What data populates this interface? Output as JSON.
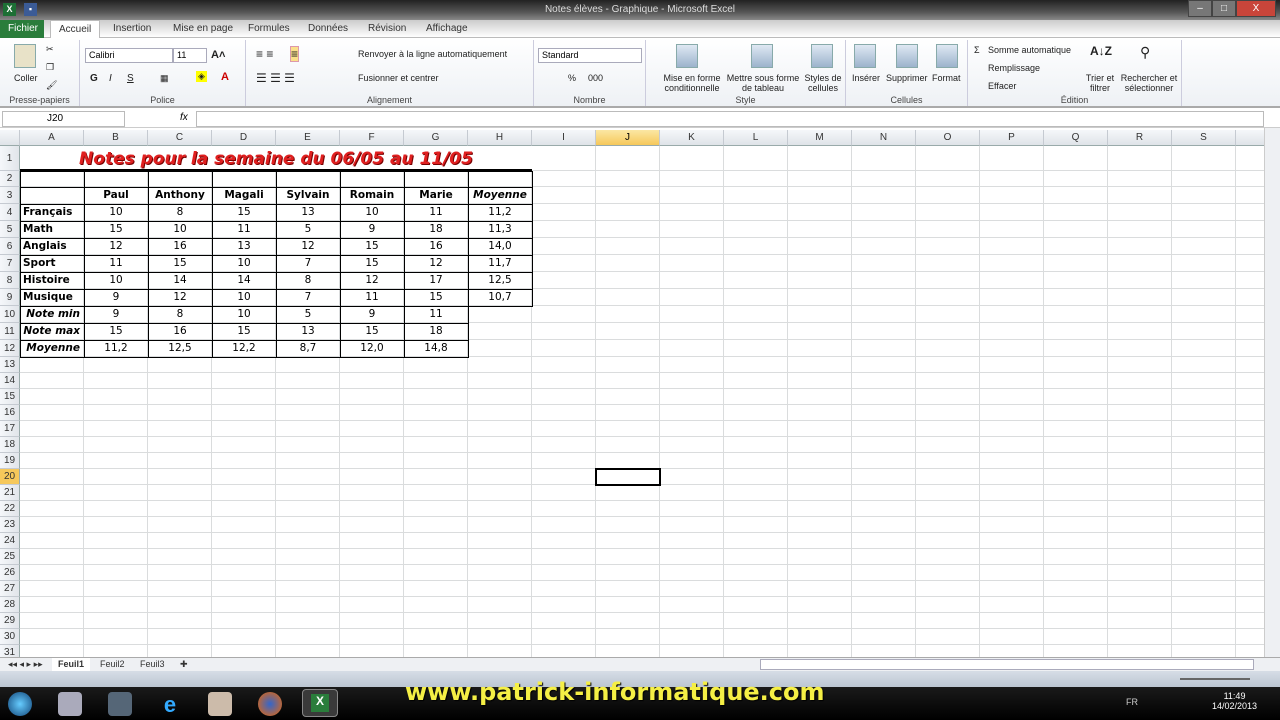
{
  "window": {
    "title": "Notes élèves - Graphique - Microsoft Excel",
    "minimize": "–",
    "maximize": "□",
    "close": "X"
  },
  "ribbon_tabs": [
    "Fichier",
    "Accueil",
    "Insertion",
    "Mise en page",
    "Formules",
    "Données",
    "Révision",
    "Affichage"
  ],
  "ribbon": {
    "clipboard": {
      "label": "Presse-papiers",
      "paste": "Coller"
    },
    "font": {
      "label": "Police",
      "name": "Calibri",
      "size": "11",
      "bold": "G",
      "italic": "I",
      "underline": "S"
    },
    "alignment": {
      "label": "Alignement",
      "wrap": "Renvoyer à la ligne automatiquement",
      "merge": "Fusionner et centrer"
    },
    "number": {
      "label": "Nombre",
      "format": "Standard",
      "percent": "%",
      "thousands": "000"
    },
    "style": {
      "label": "Style",
      "conditional": "Mise en forme conditionnelle",
      "table": "Mettre sous forme de tableau",
      "cell_styles": "Styles de cellules"
    },
    "cells": {
      "label": "Cellules",
      "insert": "Insérer",
      "delete": "Supprimer",
      "format": "Format"
    },
    "editing": {
      "label": "Édition",
      "autosum": "Somme automatique",
      "fill": "Remplissage",
      "clear": "Effacer",
      "sort": "Trier et filtrer",
      "find": "Rechercher et sélectionner"
    }
  },
  "formula_bar": {
    "name_box": "J20",
    "fx": "fx",
    "value": ""
  },
  "columns": [
    "A",
    "B",
    "C",
    "D",
    "E",
    "F",
    "G",
    "H",
    "I",
    "J",
    "K",
    "L",
    "M",
    "N",
    "O",
    "P",
    "Q",
    "R",
    "S"
  ],
  "selected_cell": "J20",
  "sheet": {
    "title": "Notes pour la semaine du 06/05 au 11/05",
    "headers": [
      "Paul",
      "Anthony",
      "Magali",
      "Sylvain",
      "Romain",
      "Marie",
      "Moyenne"
    ],
    "subjects": [
      {
        "name": "Français",
        "values": [
          "10",
          "8",
          "15",
          "13",
          "10",
          "11",
          "11,2"
        ]
      },
      {
        "name": "Math",
        "values": [
          "15",
          "10",
          "11",
          "5",
          "9",
          "18",
          "11,3"
        ]
      },
      {
        "name": "Anglais",
        "values": [
          "12",
          "16",
          "13",
          "12",
          "15",
          "16",
          "14,0"
        ]
      },
      {
        "name": "Sport",
        "values": [
          "11",
          "15",
          "10",
          "7",
          "15",
          "12",
          "11,7"
        ]
      },
      {
        "name": "Histoire",
        "values": [
          "10",
          "14",
          "14",
          "8",
          "12",
          "17",
          "12,5"
        ]
      },
      {
        "name": "Musique",
        "values": [
          "9",
          "12",
          "10",
          "7",
          "11",
          "15",
          "10,7"
        ]
      }
    ],
    "stats": [
      {
        "name": "Note min",
        "values": [
          "9",
          "8",
          "10",
          "5",
          "9",
          "11"
        ]
      },
      {
        "name": "Note max",
        "values": [
          "15",
          "16",
          "15",
          "13",
          "15",
          "18"
        ]
      },
      {
        "name": "Moyenne",
        "values": [
          "11,2",
          "12,5",
          "12,2",
          "8,7",
          "12,0",
          "14,8"
        ]
      }
    ]
  },
  "sheet_tabs": [
    "Feuil1",
    "Feuil2",
    "Feuil3"
  ],
  "active_sheet": "Feuil1",
  "taskbar": {
    "lang": "FR",
    "time": "11:49",
    "date": "14/02/2013"
  },
  "watermark": "www.patrick-informatique.com"
}
